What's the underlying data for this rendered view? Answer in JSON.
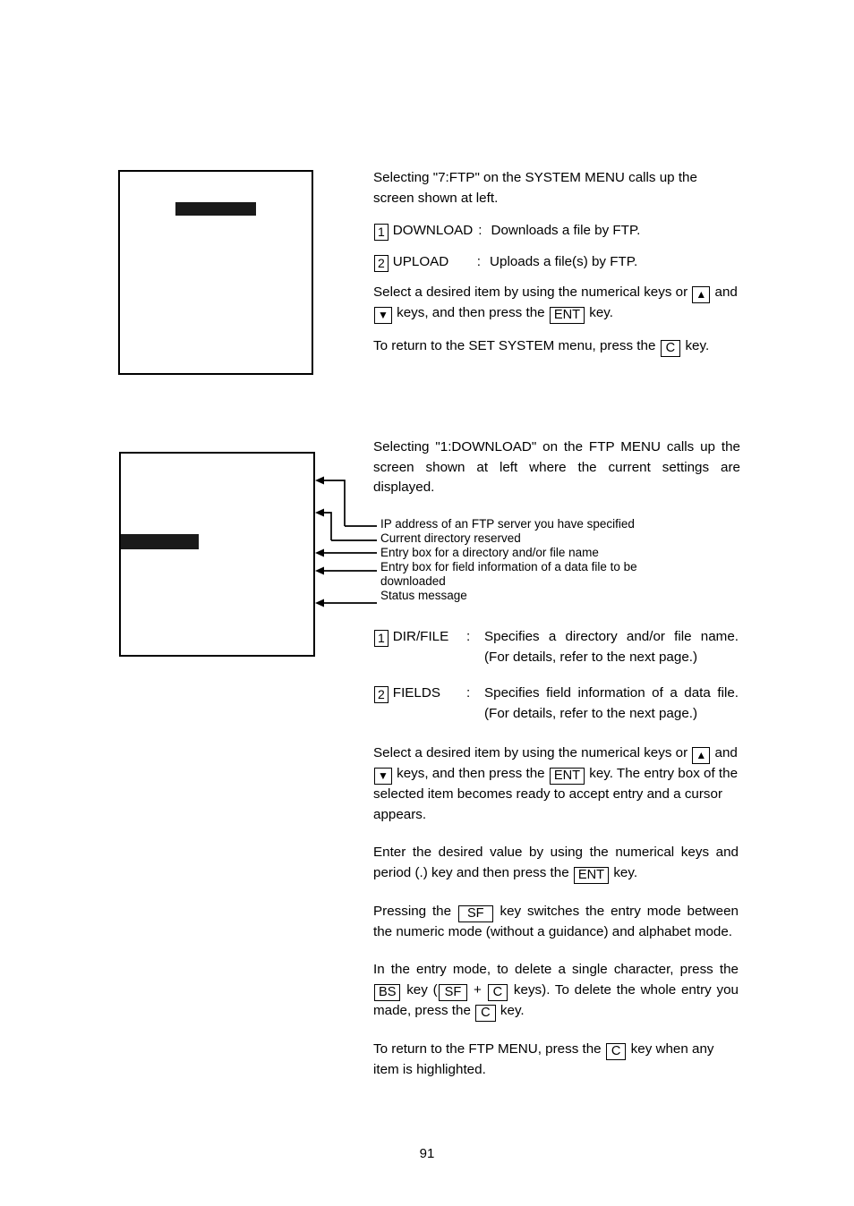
{
  "page": {
    "number": "91"
  },
  "section_ftp_menu": {
    "screen": {
      "name": "FTP MENU screen illustration",
      "highlight_bar": ""
    },
    "intro": "Selecting \"7:FTP\" on the SYSTEM MENU calls up the screen shown at left.",
    "items": [
      {
        "key": "1",
        "name": "DOWNLOAD",
        "colon": ":",
        "desc": "Downloads a file by FTP."
      },
      {
        "key": "2",
        "name": "UPLOAD",
        "colon": ":",
        "desc": "Uploads a file(s) by FTP."
      }
    ],
    "select_para": {
      "t1": "Select a desired item by using the numerical keys or",
      "key_up": "▲",
      "t2": "and",
      "key_down": "▼",
      "t3": "keys, and then press the",
      "key_ent": "ENT",
      "t4": "key."
    },
    "return_para": {
      "t1": "To return to the SET SYSTEM menu, press the",
      "key_c": "C",
      "t2": "key."
    }
  },
  "section_download": {
    "screen": {
      "name": "DOWNLOAD screen illustration",
      "highlight_bar": ""
    },
    "intro": "Selecting \"1:DOWNLOAD\" on the FTP MENU calls up the screen shown at left where the current settings are displayed.",
    "callouts": [
      "IP address of an FTP server you have specified",
      "Current directory reserved",
      "Entry box for a directory and/or file name",
      "Entry box for field information of a data file to be downloaded",
      "Status message"
    ],
    "items": [
      {
        "key": "1",
        "name": "DIR/FILE",
        "colon": ":",
        "desc": "Specifies a directory and/or file name. (For details, refer to the next page.)"
      },
      {
        "key": "2",
        "name": "FIELDS",
        "colon": ":",
        "desc": "Specifies field information of a data file. (For details, refer to the next page.)"
      }
    ],
    "select_para": {
      "t1": "Select a desired item by using the numerical keys or",
      "key_up": "▲",
      "t2": "and",
      "key_down": "▼",
      "t3": "keys, and then press the",
      "key_ent": "ENT",
      "t4": "key. The entry box of the selected item becomes ready to accept entry and a cursor appears."
    },
    "enter_para": {
      "t1": "Enter the desired value by using the numerical keys and period (.) key and then press the",
      "key_ent": "ENT",
      "t2": "key."
    },
    "sf_para": {
      "t1": "Pressing the",
      "key_sf": "SF",
      "t2": "key switches the entry mode between the numeric mode (without a guidance) and alphabet mode."
    },
    "delete_para": {
      "t1": "In the entry mode, to delete a single character, press the",
      "key_bs": "BS",
      "t2": "key (",
      "key_sf": "SF",
      "plus": "+",
      "key_c1": "C",
      "t3": "keys).  To delete the whole entry you made, press the",
      "key_c2": "C",
      "t4": "key."
    },
    "return_para": {
      "t1": "To return to the FTP MENU, press the",
      "key_c": "C",
      "t2": "key when any item is highlighted."
    }
  }
}
